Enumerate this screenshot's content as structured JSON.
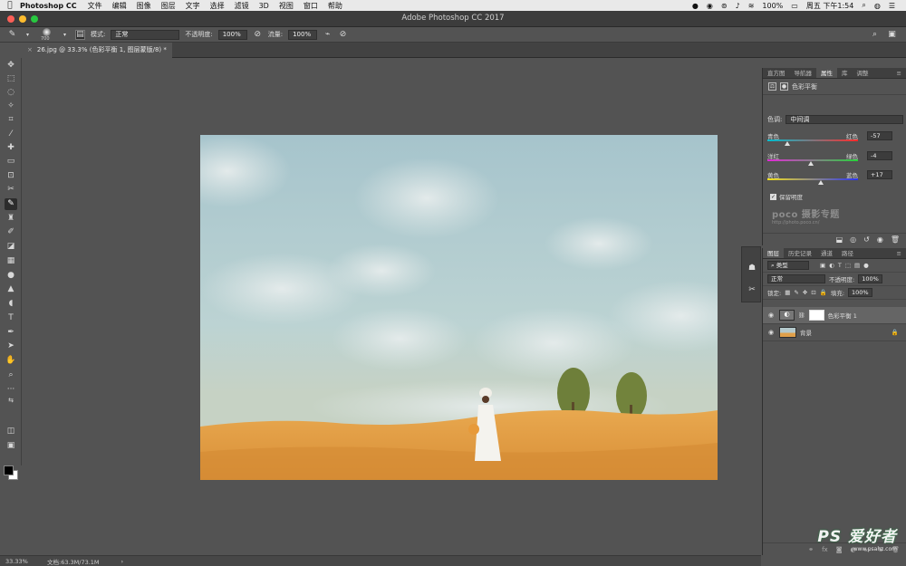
{
  "menubar": {
    "app_name": "Photoshop CC",
    "items": [
      "文件",
      "编辑",
      "图像",
      "图层",
      "文字",
      "选择",
      "滤镜",
      "3D",
      "视图",
      "窗口",
      "帮助"
    ],
    "battery": "100%",
    "clock": "周五 下午1:54"
  },
  "window": {
    "title": "Adobe Photoshop CC 2017"
  },
  "options": {
    "brush_size": "700",
    "mode_label": "模式:",
    "mode_value": "正常",
    "opacity_label": "不透明度:",
    "opacity_value": "100%",
    "flow_label": "流量:",
    "flow_value": "100%"
  },
  "document": {
    "tab_label": "26.jpg @ 33.3% (色彩平衡 1, 图层蒙版/8) *"
  },
  "status": {
    "zoom": "33.33%",
    "doc_size": "文档:63.3M/73.1M",
    "arrow": "›"
  },
  "properties_panel": {
    "tabs": [
      "直方图",
      "导航器",
      "属性",
      "库",
      "调整"
    ],
    "active_tab": "属性",
    "title": "色彩平衡",
    "tone_label": "色调:",
    "tone_value": "中间调",
    "sliders": [
      {
        "left": "青色",
        "right": "红色",
        "value": "-57",
        "level": -57
      },
      {
        "left": "洋红",
        "right": "绿色",
        "value": "-4",
        "level": -4
      },
      {
        "left": "黄色",
        "right": "蓝色",
        "value": "+17",
        "level": 17
      }
    ],
    "preserve_label": "保留明度",
    "watermark_brand": "poco 摄影专题",
    "watermark_url": "http://photo.poco.cn/"
  },
  "layers_panel": {
    "tabs": [
      "图层",
      "历史记录",
      "通道",
      "路径"
    ],
    "active_tab": "图层",
    "filter_label": "类型",
    "blend_mode": "正常",
    "opacity_label": "不透明度:",
    "opacity_value": "100%",
    "lock_label": "锁定:",
    "fill_label": "填充:",
    "fill_value": "100%",
    "layers": [
      {
        "name": "色彩平衡 1"
      },
      {
        "name": "背景"
      }
    ]
  },
  "site_watermark": {
    "brand": "PS 爱好者",
    "url": "www.psahz.com"
  },
  "colors": {
    "accent": "#535353",
    "canvas_sky": "#a6c4cc",
    "grass": "#e0a04a"
  }
}
